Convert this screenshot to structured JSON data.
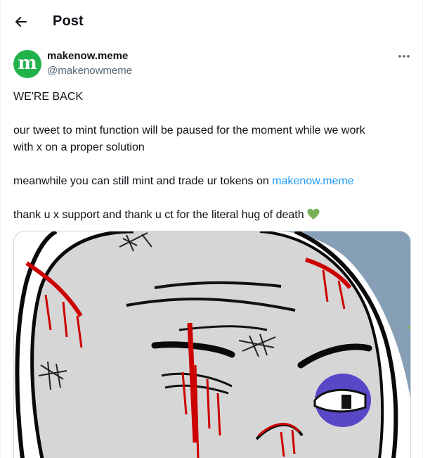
{
  "header": {
    "title": "Post"
  },
  "author": {
    "display_name": "makenow.meme",
    "handle": "@makenowmeme",
    "avatar_letter": "m",
    "avatar_color": "#22b24c"
  },
  "post": {
    "line1": "WE'RE BACK",
    "line2": "our tweet to mint function will be paused for the moment while we work",
    "line3": "with x on a proper solution",
    "line4_prefix": "meanwhile you can still mint and trade ur tokens on ",
    "line4_link": "makenow.meme",
    "line5": "thank u x support and thank u ct for the literal hug of death",
    "line5_emoji": "green-heart"
  },
  "colors": {
    "link": "#1d9bf0",
    "text": "#0f1419",
    "secondary": "#536471"
  }
}
